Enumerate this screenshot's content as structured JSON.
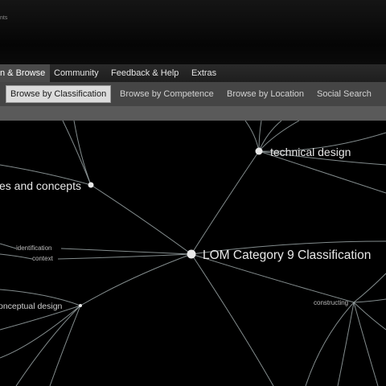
{
  "header": {
    "brand_fragment": "nts"
  },
  "main_nav": {
    "items": [
      {
        "label": "n & Browse",
        "active": true
      },
      {
        "label": "Community"
      },
      {
        "label": "Feedback & Help"
      },
      {
        "label": "Extras"
      }
    ]
  },
  "sub_nav": {
    "items": [
      {
        "label": "Browse by Classification",
        "active": true
      },
      {
        "label": "Browse by Competence"
      },
      {
        "label": "Browse by Location"
      },
      {
        "label": "Social Search"
      }
    ]
  },
  "graph": {
    "center": "LOM Category 9 Classification",
    "nodes": {
      "technical_design": "technical design",
      "principles": "es and concepts",
      "identification": "identification",
      "context": "context",
      "conceptual_design": "onceptual design",
      "constructing": "constructing"
    }
  }
}
